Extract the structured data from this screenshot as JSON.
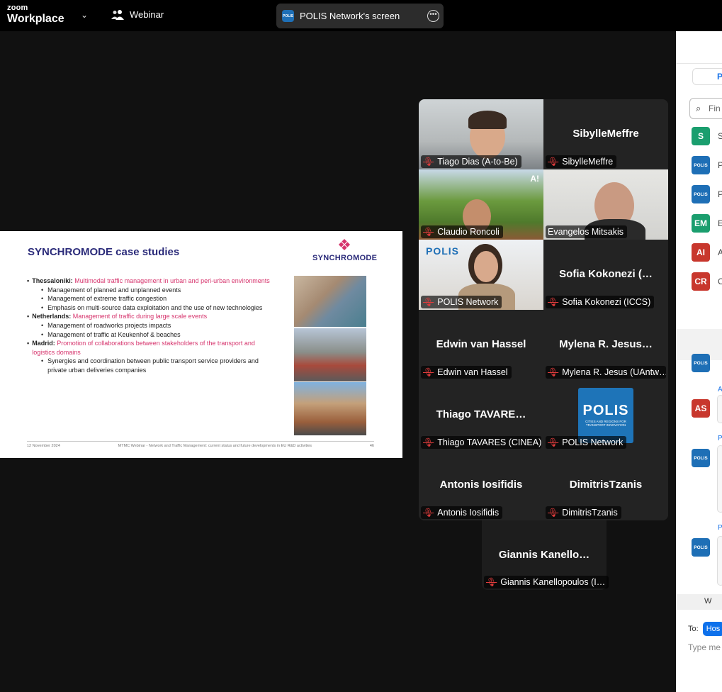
{
  "topbar": {
    "brand_small": "zoom",
    "brand_main": "Workplace",
    "webinar_label": "Webinar",
    "share_label": "POLIS Network's screen",
    "share_logo_text": "POLIS"
  },
  "slide": {
    "title": "SYNCHROMODE case studies",
    "logo_text": "SYNCHROMODE",
    "items": [
      {
        "head": "Thessaloniki:",
        "text": "Multimodal traffic management in urban and peri-urban environments"
      },
      {
        "sub": "Management of planned and unplanned events"
      },
      {
        "sub": "Management of extreme traffic congestion"
      },
      {
        "sub": "Emphasis on multi-source data exploitation and the use of new technologies"
      },
      {
        "head": "Netherlands:",
        "text": "Management of traffic during large scale events"
      },
      {
        "sub": "Management of roadworks projects impacts"
      },
      {
        "sub": "Management of traffic at Keukenhof & beaches"
      },
      {
        "head": "Madrid:",
        "text": "Promotion of collaborations between stakeholders of the transport and logistics domains"
      },
      {
        "sub": "Synergies and coordination between public transport service providers and private urban deliveries companies"
      }
    ],
    "footer_date": "12 November 2024",
    "footer_title": "MTMC Webinar - Network and Traffic Management: current status and future developments in EU R&D activities",
    "footer_page": "46"
  },
  "gallery": {
    "tiles": [
      {
        "name": "",
        "label": "Tiago Dias (A-to-Be)"
      },
      {
        "name": "SibylleMeffre",
        "label": "SibylleMeffre"
      },
      {
        "name": "",
        "label": "Claudio Roncoli",
        "badge": "A!"
      },
      {
        "name": "",
        "label": "Evangelos Mitsakis"
      },
      {
        "name": "",
        "label": "POLIS Network",
        "logo": "POLIS"
      },
      {
        "name": "Sofia  Kokonezi  (…",
        "label": "Sofia Kokonezi (ICCS)"
      },
      {
        "name": "Edwin van Hassel",
        "label": "Edwin van Hassel"
      },
      {
        "name": "Mylena  R. Jesus…",
        "label": "Mylena R. Jesus (UAntw…"
      },
      {
        "name": "Thiago  TAVARE…",
        "label": "Thiago TAVARES (CINEA)"
      },
      {
        "name": "",
        "label": "POLIS Network",
        "big_logo": "POLIS",
        "big_logo_sub": "CITIES AND REGIONS FOR TRANSPORT INNOVATION"
      },
      {
        "name": "Antonis Iosifidis",
        "label": "Antonis Iosifidis"
      },
      {
        "name": "DimitrisTzanis",
        "label": "DimitrisTzanis"
      }
    ],
    "solo": {
      "name": "Giannis  Kanello…",
      "label": "Giannis Kanellopoulos (I…"
    }
  },
  "panel": {
    "tab_label": "P",
    "find_placeholder": "Fin",
    "participants": [
      {
        "initials": "S",
        "color": "#1a9e6e",
        "rest": "S"
      },
      {
        "initials": "POLIS",
        "color": "#1e6fb6",
        "rest": "P",
        "logo": true
      },
      {
        "initials": "POLIS",
        "color": "#1e6fb6",
        "rest": "P",
        "logo": true
      },
      {
        "initials": "EM",
        "color": "#1a9e6e",
        "rest": "E"
      },
      {
        "initials": "AI",
        "color": "#c8372d",
        "rest": "A"
      },
      {
        "initials": "CR",
        "color": "#c8372d",
        "rest": "C"
      }
    ],
    "chat": [
      {
        "initials": "AS",
        "color": "#c8372d",
        "sender": "A"
      },
      {
        "initials": "POLIS",
        "color": "#1e6fb6",
        "sender": "P"
      },
      {
        "initials": "POLIS",
        "color": "#1e6fb6",
        "sender": "P"
      }
    ],
    "who_label": "W",
    "to_label": "To:",
    "to_chip": "Hos",
    "type_placeholder": "Type me"
  }
}
